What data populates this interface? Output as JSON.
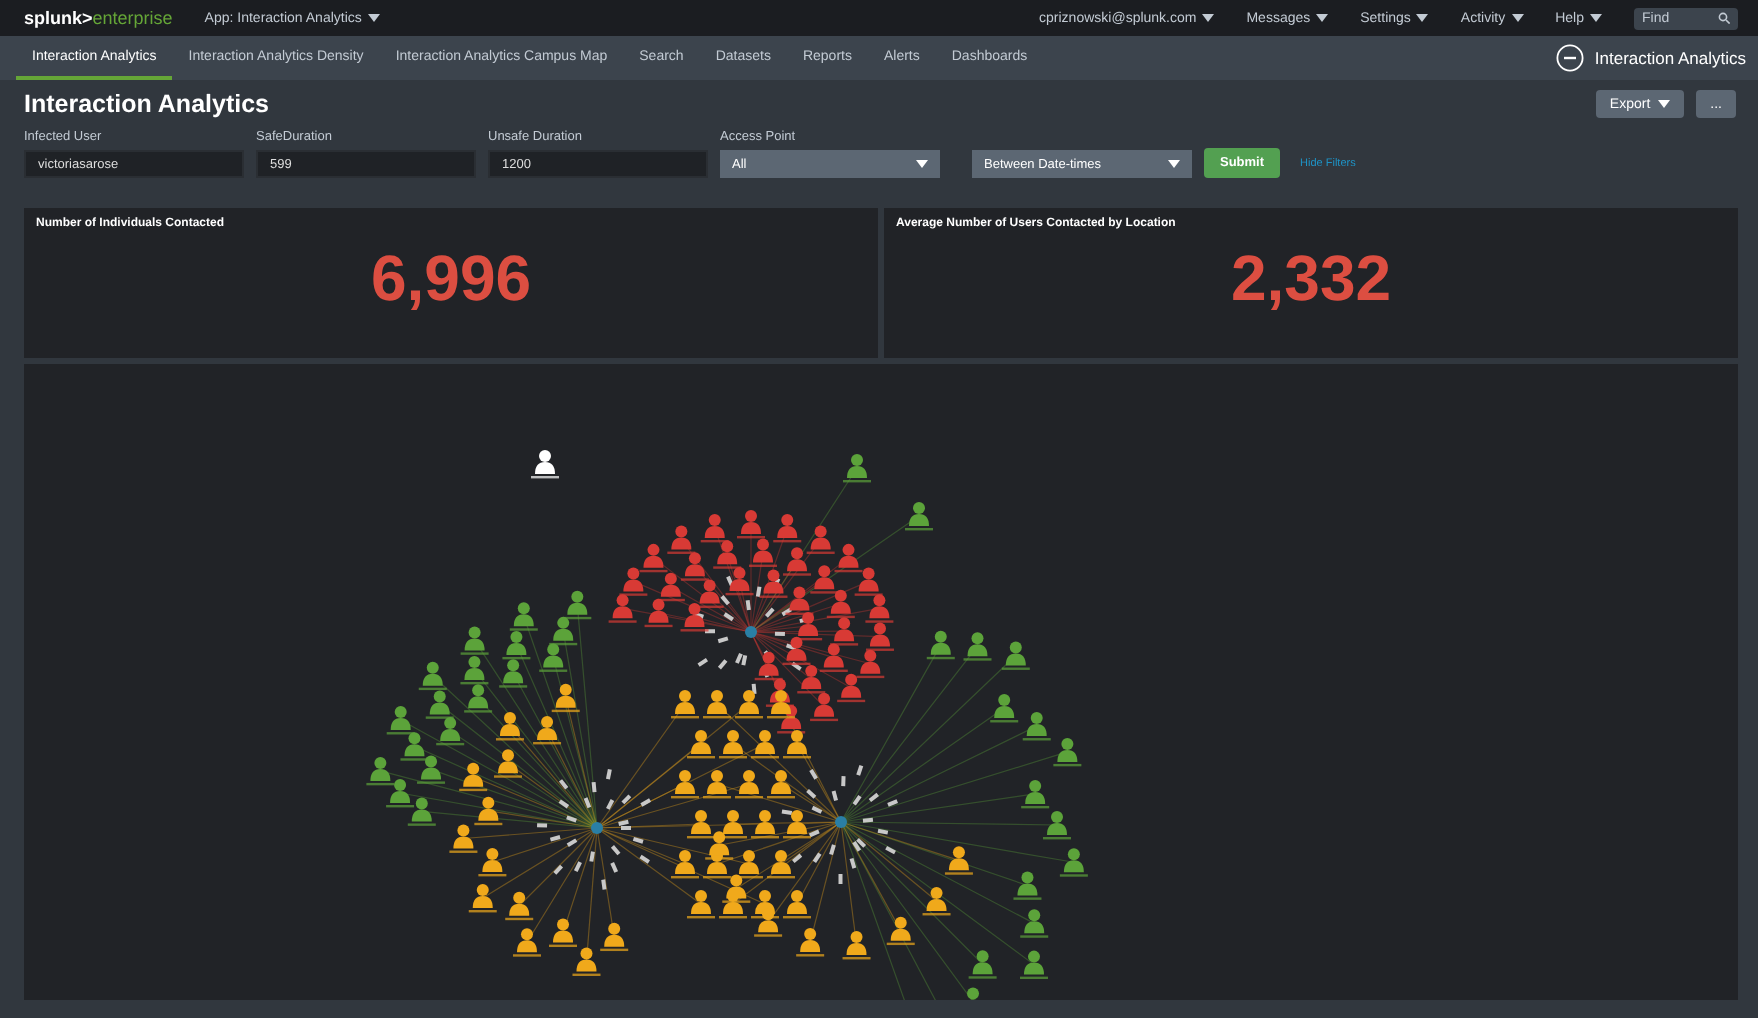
{
  "top_bar": {
    "logo": {
      "brand": "splunk>",
      "product": "enterprise"
    },
    "app_menu": "App: Interaction Analytics",
    "menus": [
      "cpriznowski@splunk.com",
      "Messages",
      "Settings",
      "Activity",
      "Help"
    ],
    "search": {
      "placeholder": "Find"
    }
  },
  "nav": {
    "tabs": [
      {
        "label": "Interaction Analytics",
        "selected": true
      },
      {
        "label": "Interaction Analytics Density",
        "selected": false
      },
      {
        "label": "Interaction Analytics Campus Map",
        "selected": false
      },
      {
        "label": "Search",
        "selected": false
      },
      {
        "label": "Datasets",
        "selected": false
      },
      {
        "label": "Reports",
        "selected": false
      },
      {
        "label": "Alerts",
        "selected": false
      },
      {
        "label": "Dashboards",
        "selected": false
      }
    ],
    "app_title": "Interaction Analytics"
  },
  "dashboard": {
    "title": "Interaction Analytics",
    "buttons": [
      {
        "label": "Export",
        "kind": "menu"
      },
      {
        "label": "...",
        "kind": "plain"
      }
    ]
  },
  "filters": [
    {
      "kind": "text",
      "label": "Infected User",
      "value": "victoriasarose"
    },
    {
      "kind": "text",
      "label": "SafeDuration",
      "value": "599"
    },
    {
      "kind": "text",
      "label": "Unsafe Duration",
      "value": "1200"
    },
    {
      "kind": "select",
      "label": "Access Point",
      "value": "All"
    },
    {
      "kind": "select",
      "value": "Between Date-times"
    }
  ],
  "submit": "Submit",
  "hide_filters": "Hide Filters",
  "panels": [
    {
      "title": "Number of Individuals Contacted",
      "value": "6,996"
    },
    {
      "title": "Average Number of Users Contacted by Location",
      "value": "2,332"
    }
  ]
}
